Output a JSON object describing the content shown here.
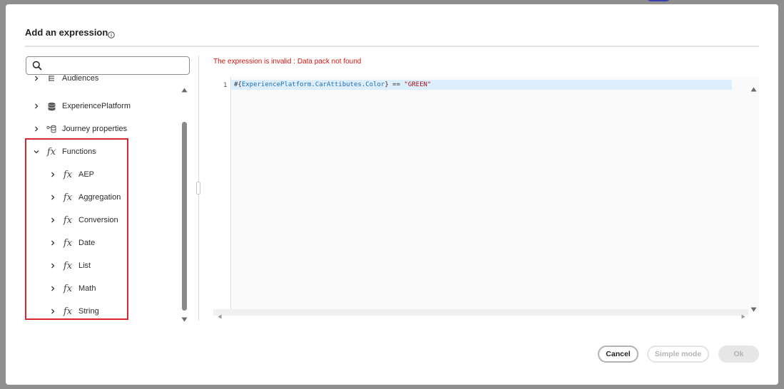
{
  "dialog": {
    "title": "Add an expression",
    "title_icon": "info-icon"
  },
  "search": {
    "value": "",
    "placeholder": "",
    "icon": "search-icon"
  },
  "tree": {
    "items": [
      {
        "label": "Audiences",
        "icon": "list-icon",
        "expanded": false
      },
      {
        "label": "ExperiencePlatform",
        "icon": "database-icon",
        "expanded": false
      },
      {
        "label": "Journey properties",
        "icon": "journey-properties-icon",
        "expanded": false
      },
      {
        "label": "Functions",
        "icon": "fx",
        "expanded": true
      },
      {
        "label": "AEP",
        "icon": "fx",
        "expanded": false
      },
      {
        "label": "Aggregation",
        "icon": "fx",
        "expanded": false
      },
      {
        "label": "Conversion",
        "icon": "fx",
        "expanded": false
      },
      {
        "label": "Date",
        "icon": "fx",
        "expanded": false
      },
      {
        "label": "List",
        "icon": "fx",
        "expanded": false
      },
      {
        "label": "Math",
        "icon": "fx",
        "expanded": false
      },
      {
        "label": "String",
        "icon": "fx",
        "expanded": false
      }
    ]
  },
  "editor": {
    "error": "The expression is invalid : Data pack not found",
    "line_number": "1",
    "code_prefix": "#{",
    "code_path": "ExperiencePlatform.CarAttibutes.Color",
    "code_middle": "} == ",
    "code_string": "\"GREEN\""
  },
  "footer": {
    "cancel_label": "Cancel",
    "simple_mode_label": "Simple mode",
    "ok_label": "Ok"
  },
  "colors": {
    "error": "#d31510",
    "highlight_border": "#d7282f",
    "line_highlight": "#ddeefc"
  }
}
